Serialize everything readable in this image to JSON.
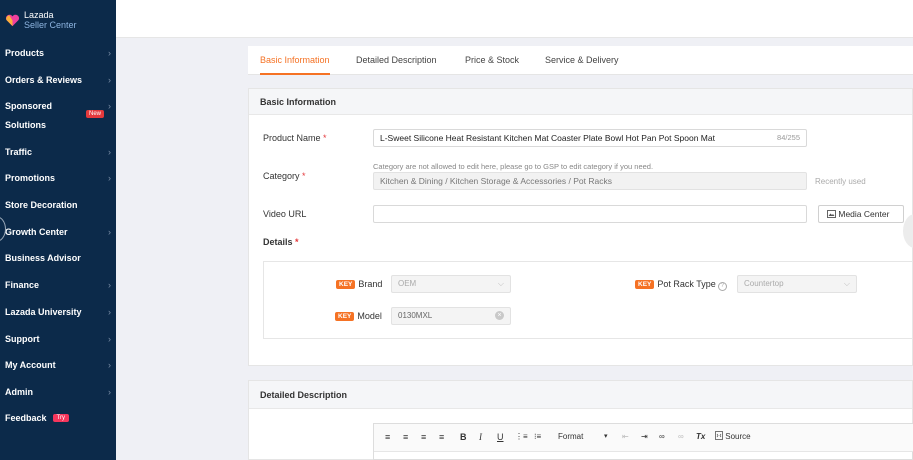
{
  "brand": {
    "name": "Lazada",
    "sub": "Seller Center"
  },
  "sidebar": {
    "items": [
      {
        "label": "Products",
        "chevron": true
      },
      {
        "label": "Orders & Reviews",
        "chevron": true
      },
      {
        "label": "Sponsored",
        "chevron": true
      },
      {
        "label": "Solutions",
        "chevron": false
      },
      {
        "label": "Traffic",
        "chevron": true
      },
      {
        "label": "Promotions",
        "chevron": true
      },
      {
        "label": "Store Decoration",
        "chevron": false
      },
      {
        "label": "Growth Center",
        "chevron": true
      },
      {
        "label": "Business Advisor",
        "chevron": false
      },
      {
        "label": "Finance",
        "chevron": true
      },
      {
        "label": "Lazada University",
        "chevron": true
      },
      {
        "label": "Support",
        "chevron": true
      },
      {
        "label": "My Account",
        "chevron": true
      },
      {
        "label": "Admin",
        "chevron": true
      },
      {
        "label": "Feedback",
        "chevron": false
      }
    ],
    "new_badge": "New",
    "try_badge": "Try",
    "chevron_glyph": "›"
  },
  "tabs": [
    {
      "label": "Basic Information",
      "active": true
    },
    {
      "label": "Detailed Description",
      "active": false
    },
    {
      "label": "Price & Stock",
      "active": false
    },
    {
      "label": "Service & Delivery",
      "active": false
    }
  ],
  "basic": {
    "heading": "Basic Information",
    "product_name": {
      "label": "Product Name",
      "required": "*",
      "value": "L-Sweet Silicone Heat Resistant Kitchen Mat Coaster Plate Bowl Hot Pan Pot Spoon Mat",
      "counter": "84/255"
    },
    "category": {
      "label": "Category",
      "required": "*",
      "hint": "Category are not allowed to edit here, please go to GSP to edit category if you need.",
      "value": "Kitchen & Dining / Kitchen Storage & Accessories / Pot Racks",
      "recent": "Recently used"
    },
    "video": {
      "label": "Video URL",
      "value": "",
      "button": "Media Center"
    },
    "details": {
      "label": "Details",
      "required": "*",
      "key_badge": "KEY",
      "brand": {
        "label": "Brand",
        "value": "OEM"
      },
      "pot_rack_type": {
        "label": "Pot Rack Type",
        "value": "Countertop"
      },
      "model": {
        "label": "Model",
        "value": "0130MXL"
      }
    }
  },
  "description": {
    "heading": "Detailed Description",
    "toolbar": {
      "format": "Format",
      "source": "Source",
      "bold": "B",
      "italic": "I",
      "underline": "U",
      "clear_format": "Tx"
    }
  },
  "colors": {
    "accent": "#f57224",
    "sidebar": "#0c2a4a",
    "required": "#e4393c"
  }
}
